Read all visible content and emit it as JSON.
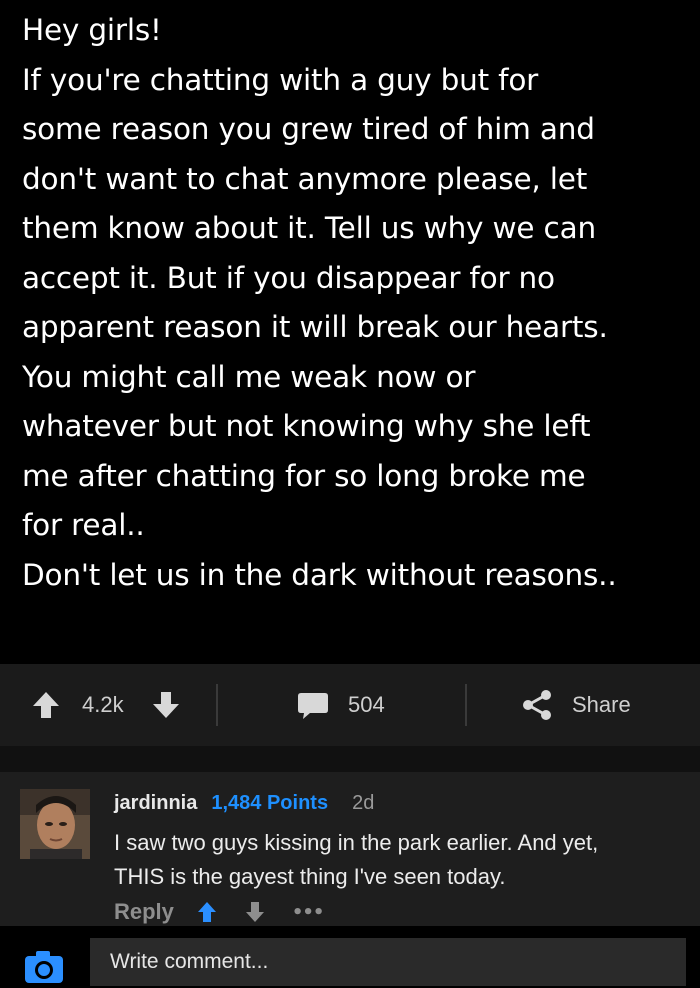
{
  "post": {
    "lines": [
      "Hey girls!",
      "If you're chatting with a guy but for",
      "some reason you grew tired of him and",
      "don't want to chat anymore please, let",
      "them know about it. Tell us why we can",
      "accept it. But if you disappear for no",
      "apparent reason it will break our hearts.",
      "You might call me weak now or",
      "whatever but not knowing why she left",
      "me after chatting for so long broke me",
      "for real..",
      "Don't let us in the dark without reasons.."
    ]
  },
  "actions": {
    "upvotes": "4.2k",
    "comments": "504",
    "share_label": "Share",
    "icons": [
      "upvote-icon",
      "downvote-icon",
      "comment-icon",
      "share-icon"
    ]
  },
  "comment": {
    "username": "jardinnia",
    "points": "1,484 Points",
    "time": "2d",
    "body_lines": [
      "I saw two guys kissing in the park earlier. And yet,",
      "THIS is the gayest thing I've seen today."
    ],
    "reply_label": "Reply",
    "more": "•••",
    "points_color": "#1e90ff"
  },
  "composer": {
    "placeholder": "Write comment...",
    "accent": "#2b8fff"
  }
}
